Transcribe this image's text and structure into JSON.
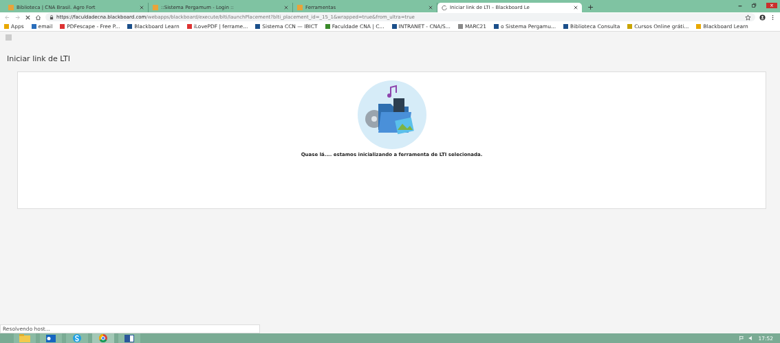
{
  "tabs": [
    {
      "title": "Biblioteca | CNA Brasil. Agro Fort",
      "selected": false,
      "loading": false
    },
    {
      "title": "::Sistema Pergamum - Login ::",
      "selected": false,
      "loading": false
    },
    {
      "title": "Ferramentas",
      "selected": false,
      "loading": false
    },
    {
      "title": "Iniciar link de LTI – Blackboard Le",
      "selected": true,
      "loading": true
    }
  ],
  "new_tab": "+",
  "address": {
    "host": "https://faculdadecna.blackboard.com",
    "path": "/webapps/blackboard/execute/blti/launchPlacement?blti_placement_id=_15_1&wrapped=true&from_ultra=true"
  },
  "bookmarks": [
    "Apps",
    "email",
    "PDFescape - Free P...",
    "Blackboard Learn",
    "iLovePDF | ferrame...",
    "Sistema CCN — IBICT",
    "Faculdade CNA | C...",
    "INTRANET - CNA/S...",
    "MARC21",
    "o Sistema Pergamu...",
    "Biblioteca Consulta",
    "Cursos Online gráti...",
    "Blackboard Learn"
  ],
  "page": {
    "heading": "Iniciar link de LTI",
    "message": "Quase lá.... estamos inicializando a ferramenta de LTI selecionada."
  },
  "status_bar": "Resolvendo host...",
  "taskbar": {
    "time": "17:52"
  }
}
